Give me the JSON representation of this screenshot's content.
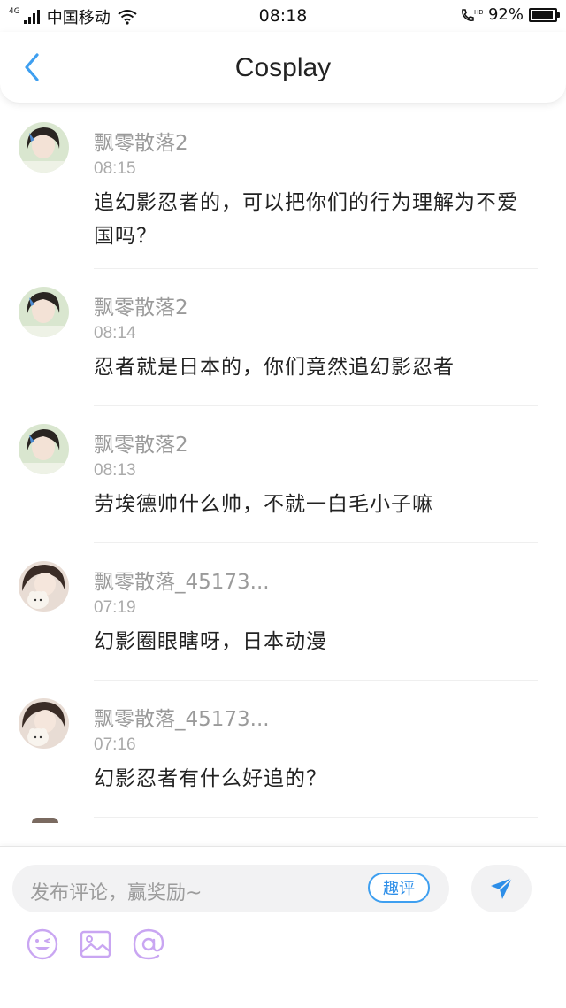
{
  "status_bar": {
    "network_type": "4G",
    "carrier": "中国移动",
    "time": "08:18",
    "call_indicator": "HD",
    "battery_percent": "92%",
    "battery_level": 0.92
  },
  "header": {
    "title": "Cosplay",
    "back_icon": "chevron-left-icon"
  },
  "comments": [
    {
      "user": "飘零散落2",
      "time": "08:15",
      "text": "追幻影忍者的，可以把你们的行为理解为不爱国吗？"
    },
    {
      "user": "飘零散落2",
      "time": "08:14",
      "text": "忍者就是日本的，你们竟然追幻影忍者"
    },
    {
      "user": "飘零散落2",
      "time": "08:13",
      "text": "劳埃德帅什么帅，不就一白毛小子嘛"
    },
    {
      "user": "飘零散落_45173...",
      "time": "07:19",
      "text": "幻影圈眼瞎呀，日本动漫"
    },
    {
      "user": "飘零散落_45173...",
      "time": "07:16",
      "text": "幻影忍者有什么好追的？"
    }
  ],
  "composer": {
    "placeholder": "发布评论，赢奖励~",
    "quick_comment_label": "趣评",
    "send_icon": "send-icon",
    "tools": [
      "emoji-icon",
      "image-icon",
      "mention-icon"
    ]
  },
  "colors": {
    "accent": "#3e9ff0",
    "tool_icon": "#c9a6f2"
  }
}
